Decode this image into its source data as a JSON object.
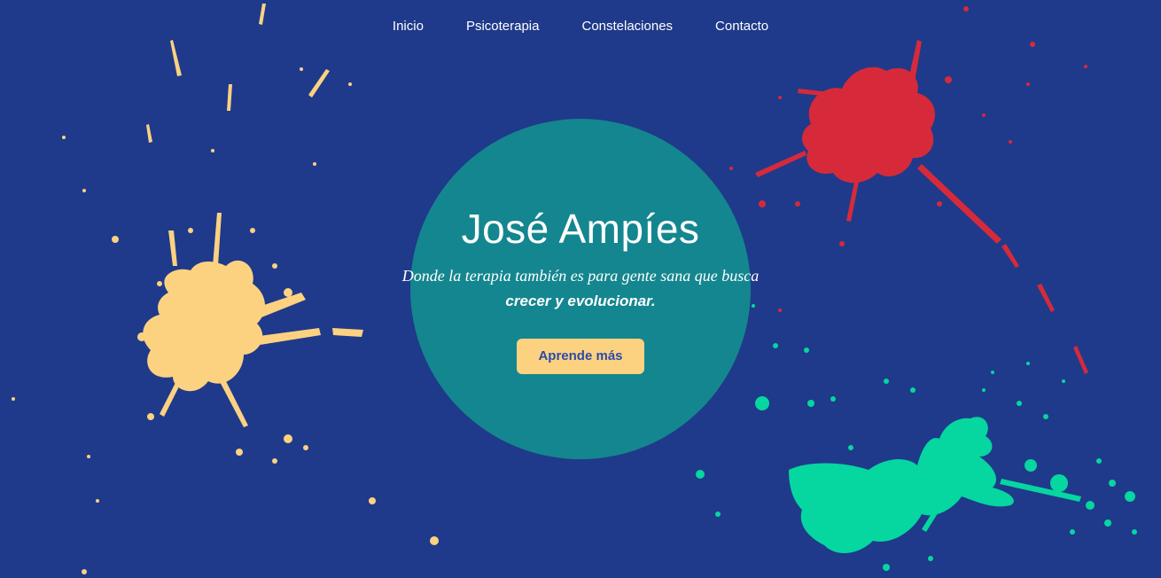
{
  "nav": {
    "items": [
      {
        "label": "Inicio"
      },
      {
        "label": "Psicoterapia"
      },
      {
        "label": "Constelaciones"
      },
      {
        "label": "Contacto"
      }
    ]
  },
  "hero": {
    "title": "José Ampíes",
    "tagline_regular": "Donde la terapia también es para gente sana que busca",
    "tagline_bold": "crecer y evolucionar.",
    "button_label": "Aprende más"
  },
  "colors": {
    "background": "#1f3a8a",
    "circle": "#14868f",
    "splash_yellow": "#fcd281",
    "splash_red": "#d62a3a",
    "splash_green": "#06d6a0",
    "button_text": "#2d4aa8"
  }
}
